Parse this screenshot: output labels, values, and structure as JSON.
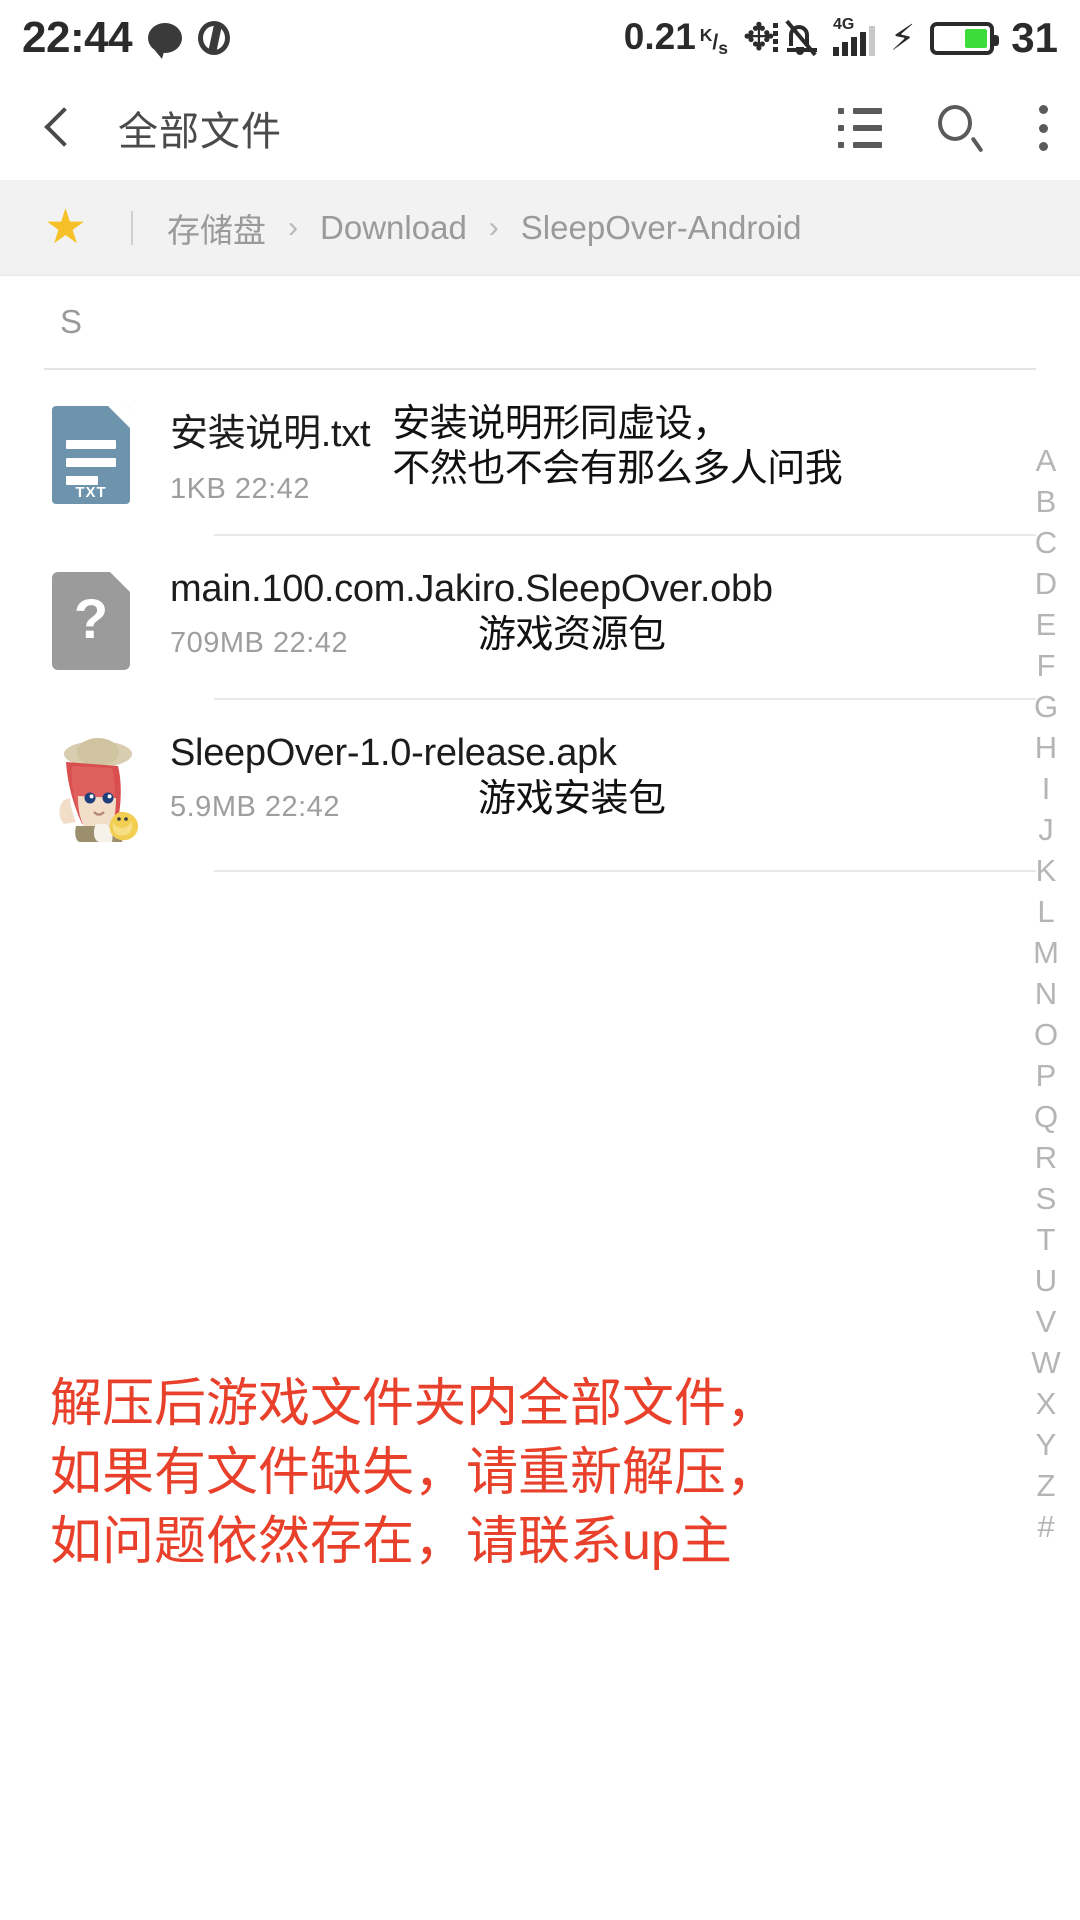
{
  "status_bar": {
    "clock": "22:44",
    "chat_icon": "chat-bubble-icon",
    "app_icon": "app-glyph-icon",
    "net_speed": "0.21",
    "net_speed_unit_top": "K",
    "net_speed_unit_bottom": "s",
    "bluetooth_icon": "bluetooth-icon",
    "mute_icon": "bell-muted-icon",
    "network_type": "4G",
    "charging_icon": "lightning-bolt-icon",
    "battery_percent": "31"
  },
  "app_bar": {
    "back_icon": "back-chevron-icon",
    "title": "全部文件",
    "list_icon": "list-view-icon",
    "search_icon": "search-icon",
    "more_icon": "overflow-menu-icon"
  },
  "breadcrumb": {
    "star_icon": "★",
    "items": [
      {
        "label": "存储盘"
      },
      {
        "label": "Download"
      },
      {
        "label": "SleepOver-Android"
      }
    ],
    "separator": "›"
  },
  "list": {
    "section_header": "S",
    "files": [
      {
        "icon": "txt-file-icon",
        "icon_tag": "TXT",
        "name": "安装说明.txt",
        "size": "1KB",
        "time": "22:42",
        "meta": "1KB  22:42",
        "annotation": "安装说明形同虚设，\n不然也不会有那么多人问我"
      },
      {
        "icon": "unknown-file-icon",
        "icon_tag": "?",
        "name": "main.100.com.Jakiro.SleepOver.obb",
        "size": "709MB",
        "time": "22:42",
        "meta": "709MB  22:42",
        "annotation": "游戏资源包"
      },
      {
        "icon": "apk-app-icon",
        "icon_tag": "",
        "name": "SleepOver-1.0-release.apk",
        "size": "5.9MB",
        "time": "22:42",
        "meta": "5.9MB  22:42",
        "annotation": "游戏安装包"
      }
    ]
  },
  "index_strip": {
    "letters": [
      "A",
      "B",
      "C",
      "D",
      "E",
      "F",
      "G",
      "H",
      "I",
      "J",
      "K",
      "L",
      "M",
      "N",
      "O",
      "P",
      "Q",
      "R",
      "S",
      "T",
      "U",
      "V",
      "W",
      "X",
      "Y",
      "Z",
      "#"
    ]
  },
  "red_note": {
    "text": "解压后游戏文件夹内全部文件，\n如果有文件缺失，请重新解压，\n如问题依然存在，请联系up主"
  },
  "colors": {
    "accent_star": "#f5c028",
    "red_note": "#e8402a",
    "breadcrumb_bg": "#f2f2f2",
    "txt_icon": "#6d93ad",
    "unknown_icon": "#9b9b9b",
    "battery_green": "#3ddc3d"
  }
}
